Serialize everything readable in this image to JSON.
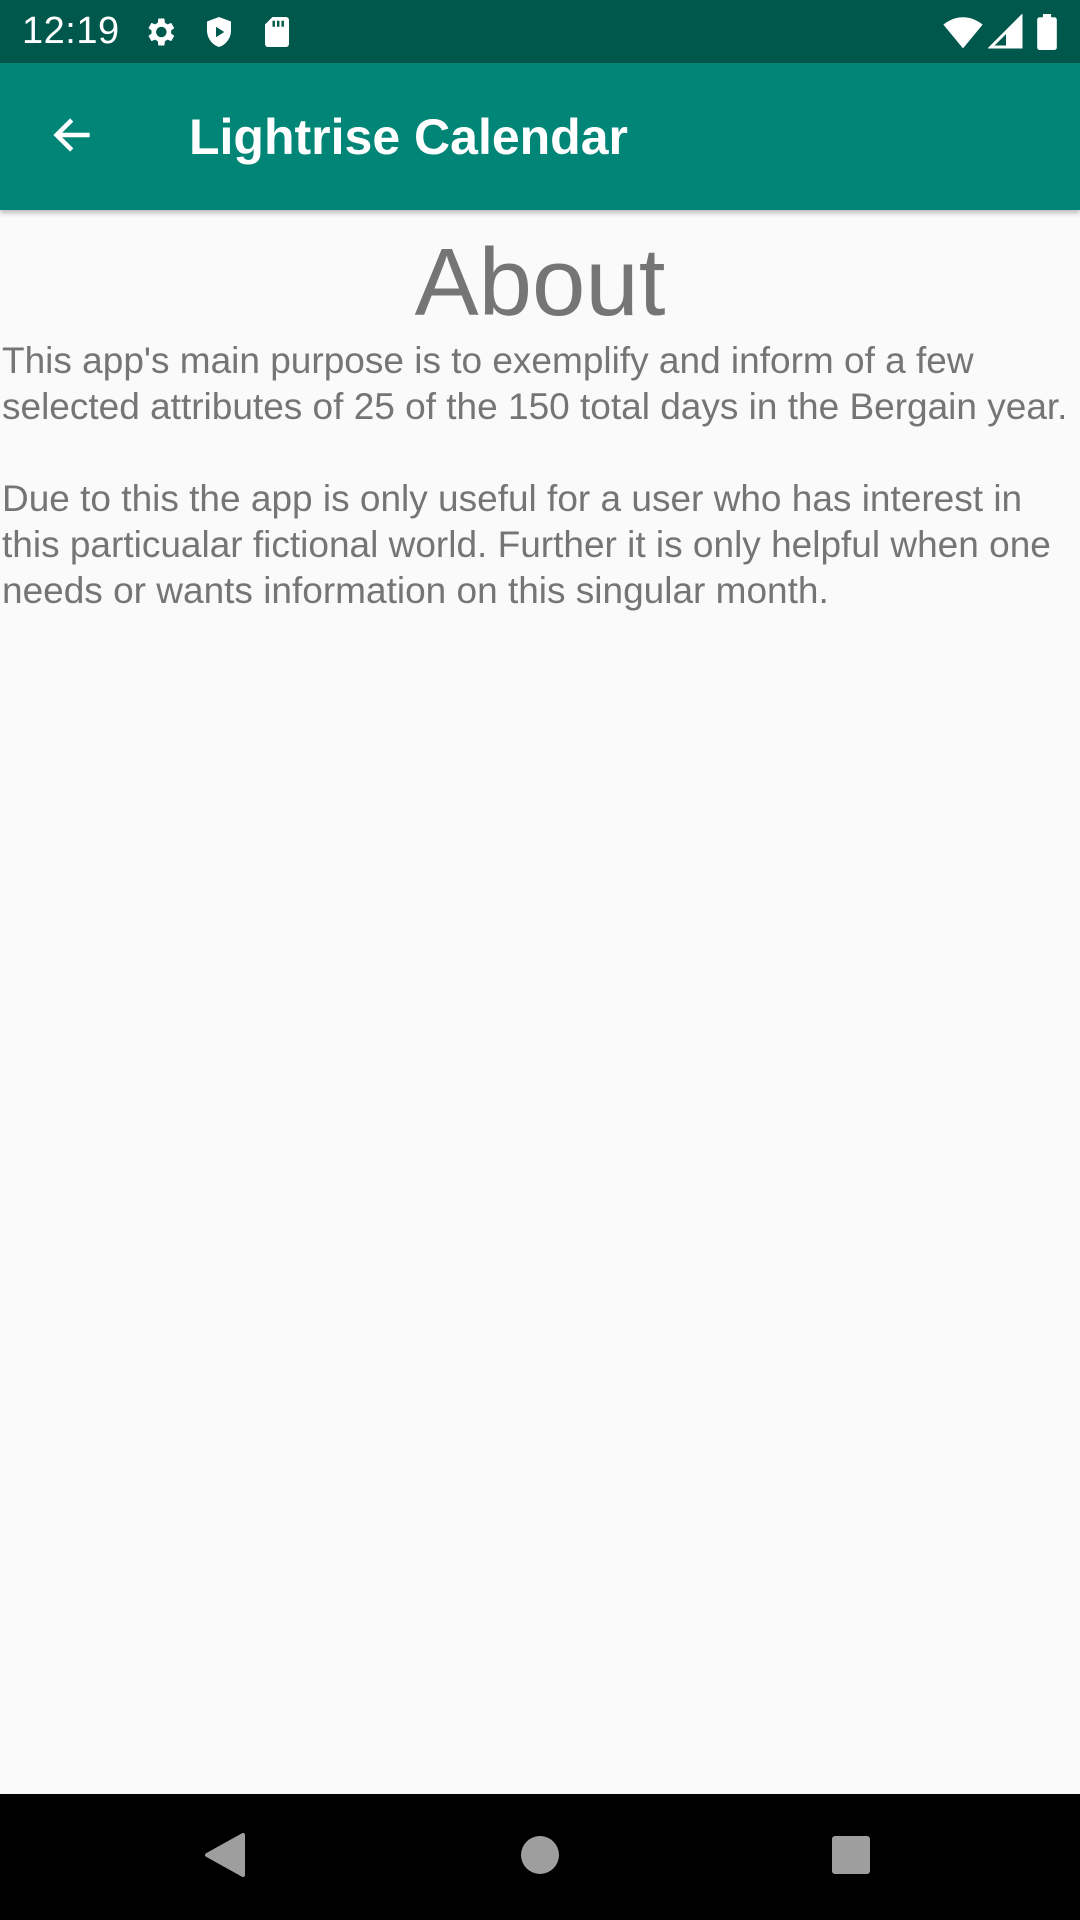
{
  "status_bar": {
    "time": "12:19",
    "icons": [
      "gear-icon",
      "shield-icon",
      "sd-card-icon",
      "wifi-icon",
      "signal-icon",
      "battery-icon"
    ],
    "background": "#00574b"
  },
  "app_bar": {
    "title": "Lightrise Calendar",
    "back_icon": "arrow-back-icon",
    "background": "#008577"
  },
  "main": {
    "heading": "About",
    "paragraphs": [
      "This app's main purpose is to exemplify and inform of a few selected attributes of 25 of the 150 total days in the Bergain year.",
      "Due to this the app is only useful for a user who has interest in this particualar fictional world. Further it is only helpful when one needs or wants information on this singular month."
    ],
    "text_color": "#757575"
  },
  "nav_bar": {
    "buttons": [
      "back-triangle-icon",
      "home-circle-icon",
      "recents-square-icon"
    ]
  }
}
